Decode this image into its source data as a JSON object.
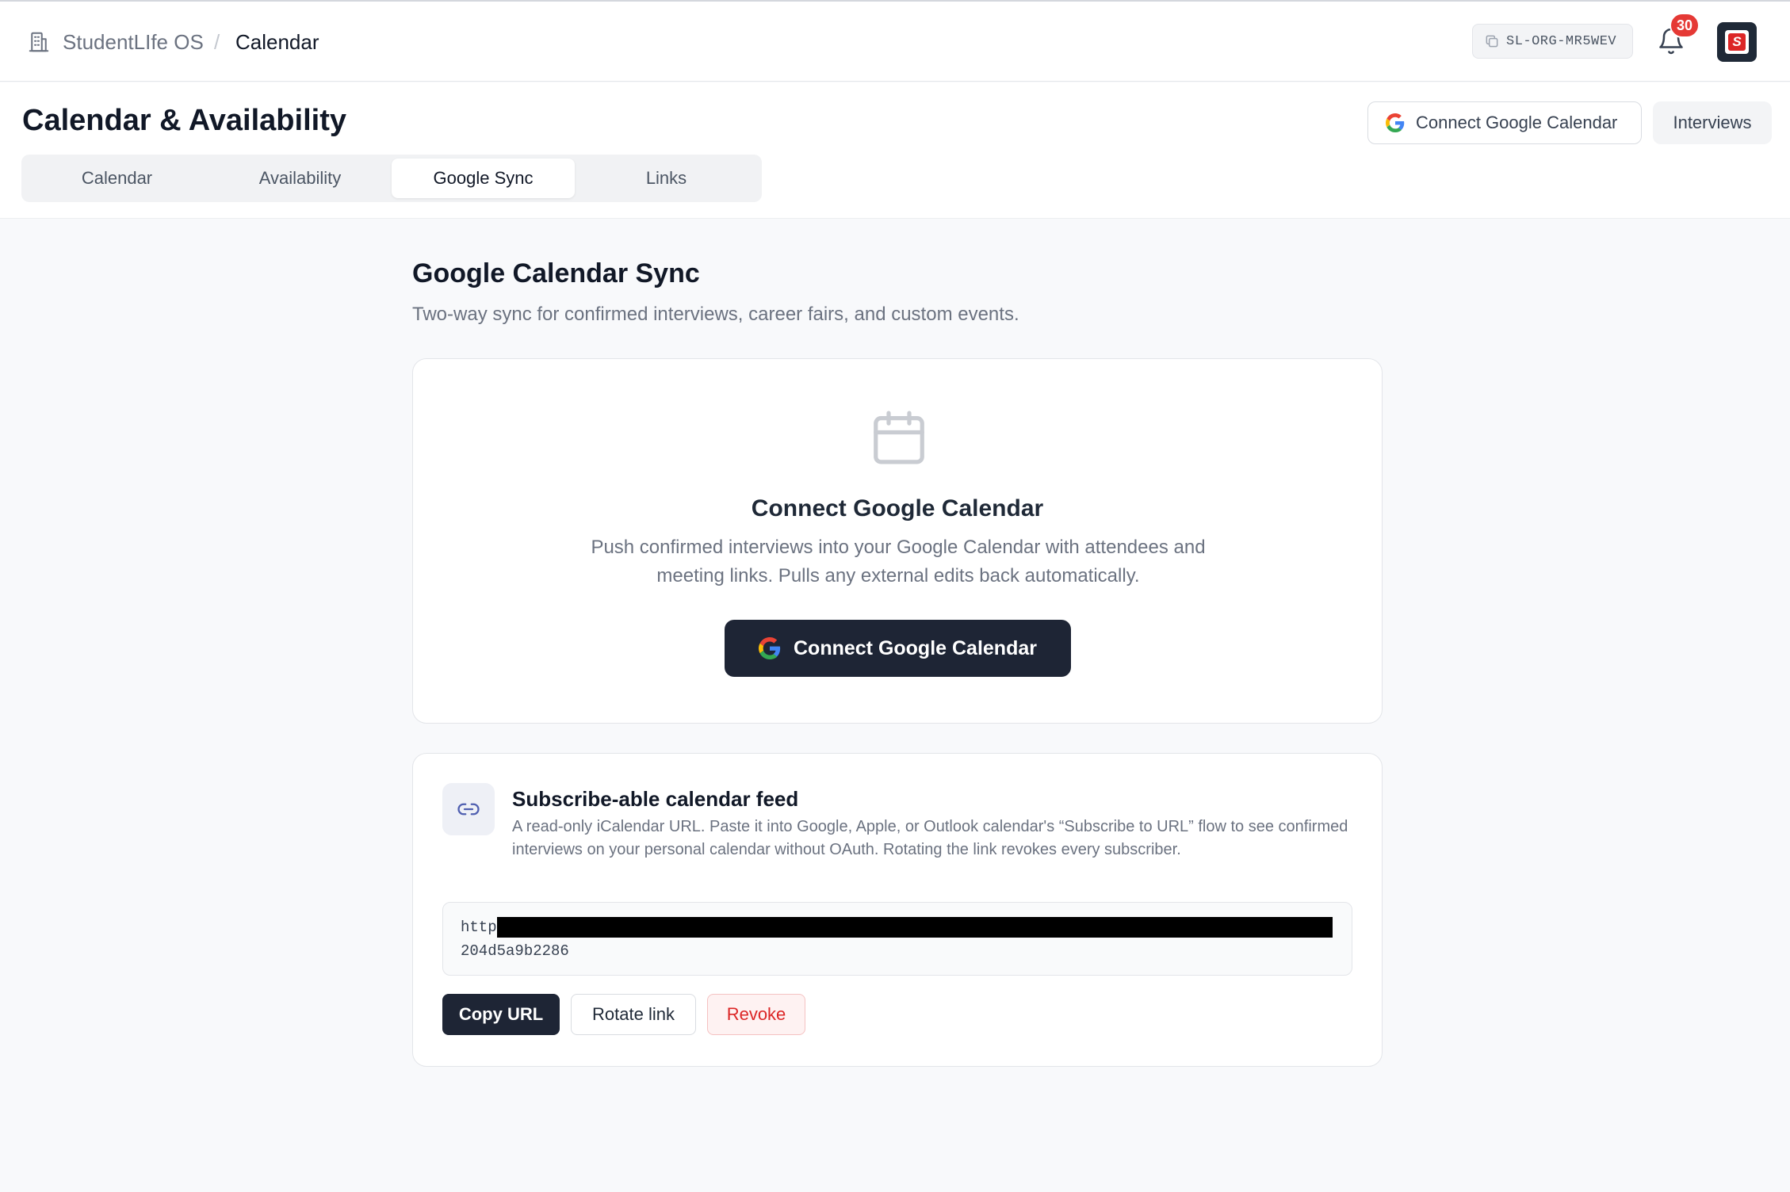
{
  "header": {
    "breadcrumb": {
      "app": "StudentLIfe OS",
      "separator": "/",
      "page": "Calendar"
    },
    "org_code": "SL-ORG-MR5WEV",
    "notifications_count": "30",
    "avatar_letter": "S"
  },
  "page": {
    "title": "Calendar & Availability",
    "actions": {
      "connect_google": "Connect Google Calendar",
      "interviews": "Interviews"
    },
    "tabs": [
      {
        "label": "Calendar",
        "active": false
      },
      {
        "label": "Availability",
        "active": false
      },
      {
        "label": "Google Sync",
        "active": true
      },
      {
        "label": "Links",
        "active": false
      }
    ]
  },
  "sync": {
    "title": "Google Calendar Sync",
    "subtitle": "Two-way sync for confirmed interviews, career fairs, and custom events.",
    "connect_card": {
      "icon": "calendar-icon",
      "title": "Connect Google Calendar",
      "description": "Push confirmed interviews into your Google Calendar with attendees and meeting links. Pulls any external edits back automatically.",
      "button": "Connect Google Calendar"
    },
    "feed_card": {
      "icon": "link-icon",
      "title": "Subscribe-able calendar feed",
      "description": "A read-only iCalendar URL. Paste it into Google, Apple, or Outlook calendar's “Subscribe to URL” flow to see confirmed interviews on your personal calendar without OAuth. Rotating the link revokes every subscriber.",
      "url_prefix": "http",
      "url_suffix": "204d5a9b2286",
      "buttons": {
        "copy": "Copy URL",
        "rotate": "Rotate link",
        "revoke": "Revoke"
      }
    }
  },
  "colors": {
    "primary_dark": "#1e2535",
    "badge_red": "#e53935",
    "revoke_red": "#dc2626",
    "page_bg": "#f8f9fb"
  }
}
